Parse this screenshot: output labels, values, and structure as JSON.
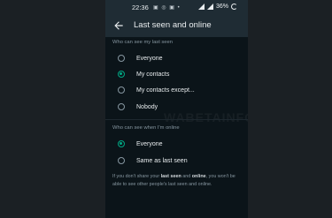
{
  "status_bar": {
    "time": "22:36",
    "left_icons": "▣ ◎ ▣ •",
    "battery": "36%"
  },
  "app_bar": {
    "title": "Last seen and online"
  },
  "last_seen": {
    "label": "Who can see my last seen",
    "options": [
      {
        "label": "Everyone",
        "selected": false
      },
      {
        "label": "My contacts",
        "selected": true
      },
      {
        "label": "My contacts except...",
        "selected": false
      },
      {
        "label": "Nobody",
        "selected": false
      }
    ]
  },
  "online": {
    "label": "Who can see when I'm online",
    "options": [
      {
        "label": "Everyone",
        "selected": true
      },
      {
        "label": "Same as last seen",
        "selected": false
      }
    ]
  },
  "footnote": {
    "prefix": "If you don't share your ",
    "bold1": "last seen",
    "mid": " and ",
    "bold2": "online",
    "suffix": ", you won't be able to see other people's last seen and online."
  },
  "watermark": {
    "text": "WABETAINFO"
  },
  "colors": {
    "accent": "#00a884",
    "background": "#0b1419",
    "bar": "#1f2c34"
  }
}
